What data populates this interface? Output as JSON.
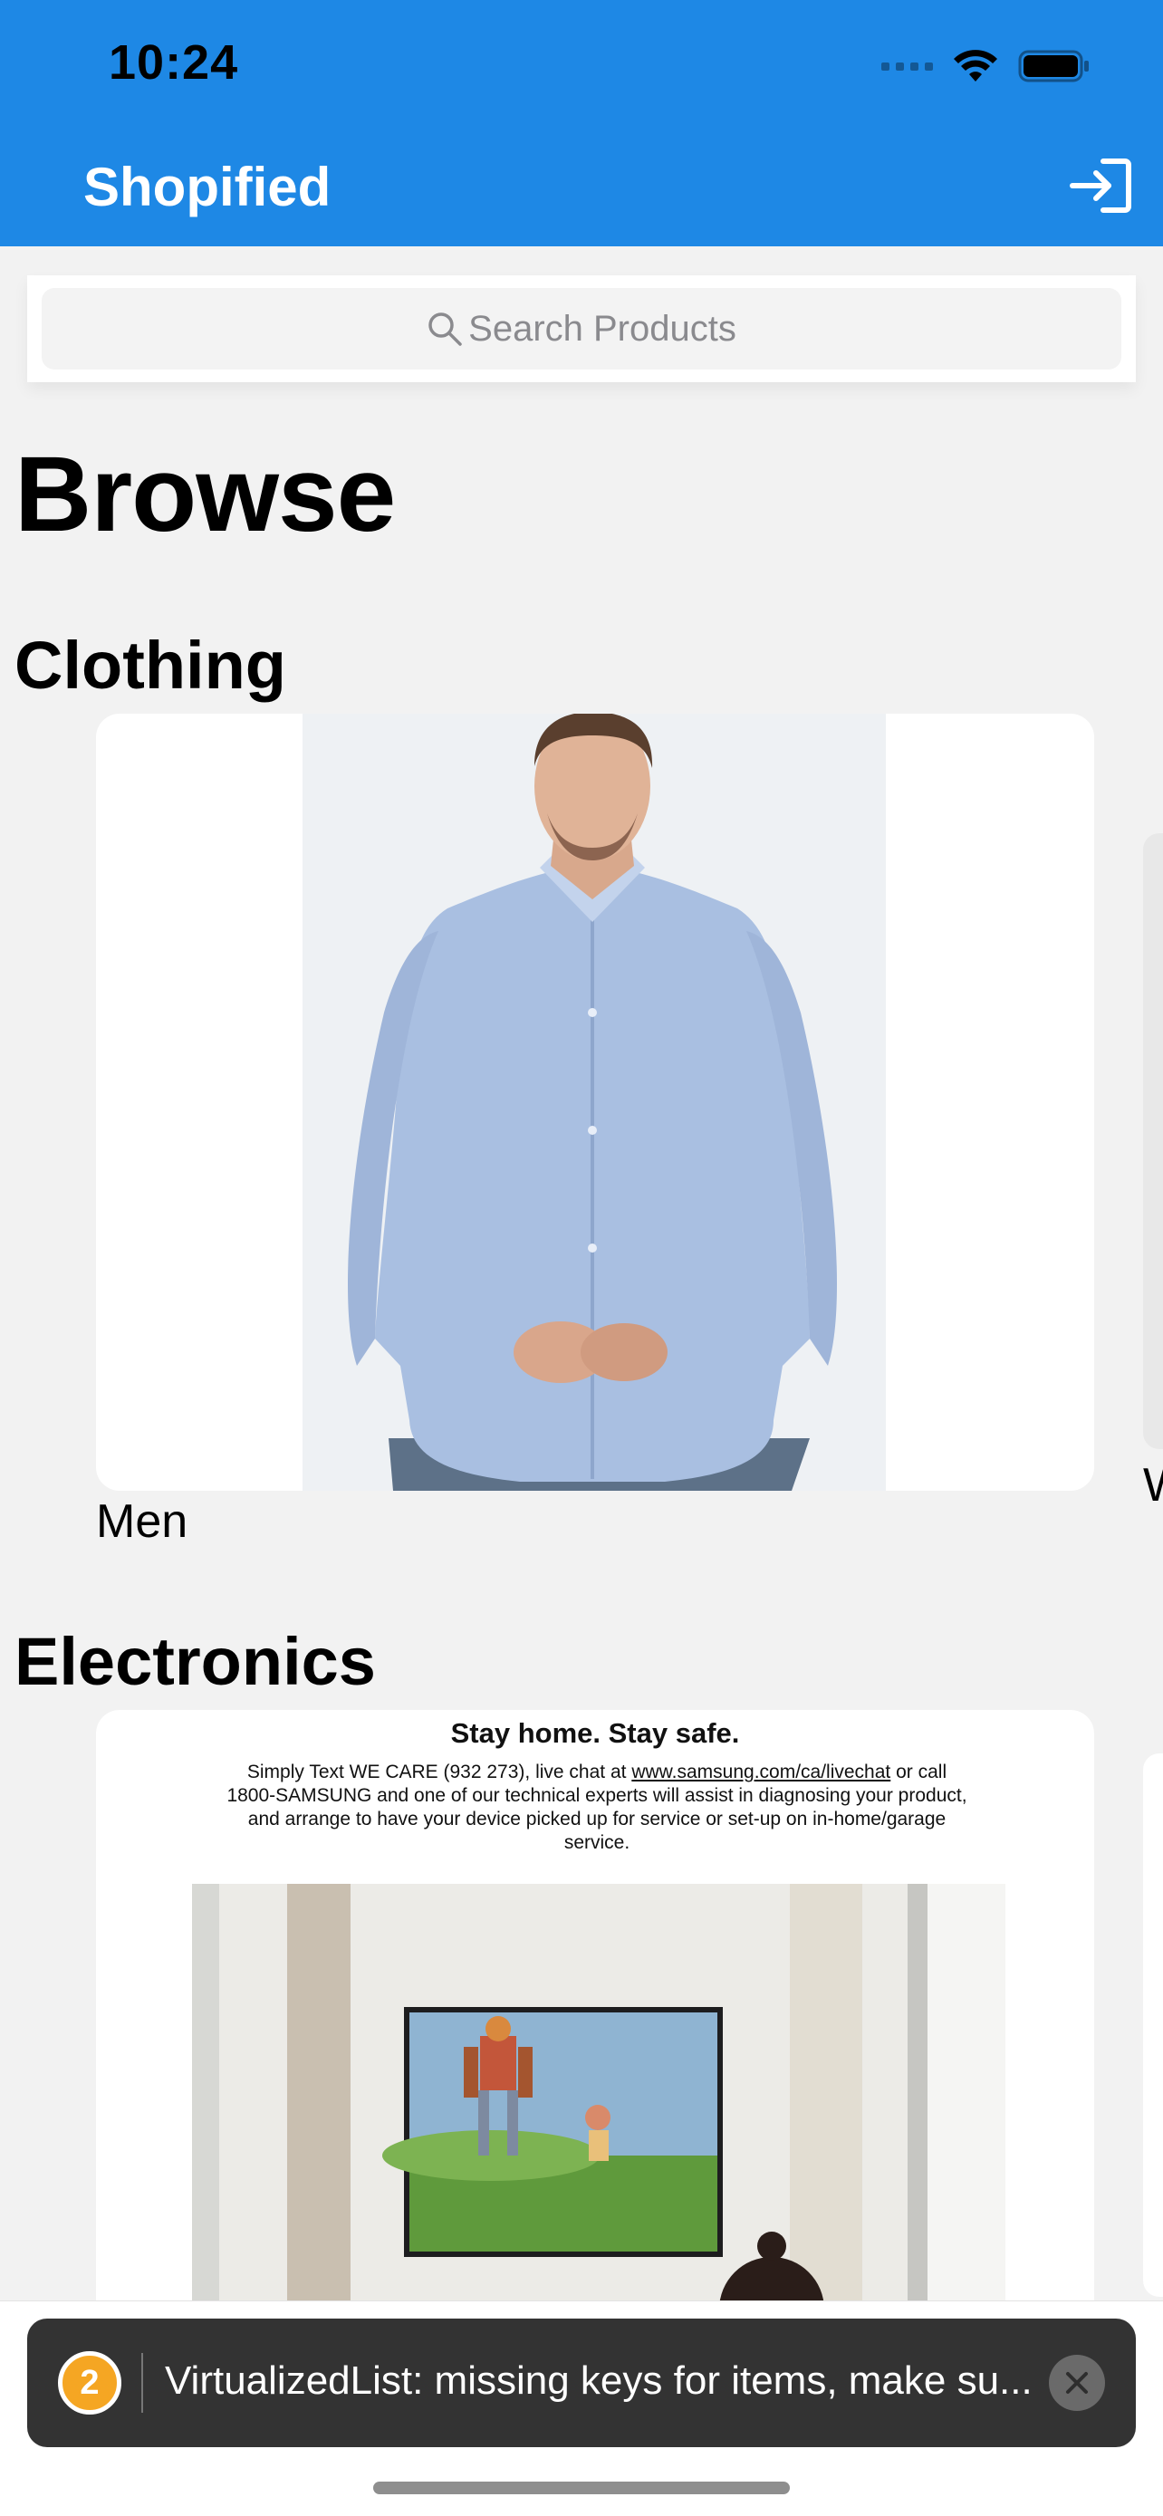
{
  "status_bar": {
    "time": "10:24"
  },
  "header": {
    "title": "Shopified",
    "login_icon": "login-arrow-icon"
  },
  "search": {
    "placeholder": "Search Products",
    "icon": "search-icon"
  },
  "browse_title": "Browse",
  "sections": [
    {
      "title": "Clothing",
      "items": [
        {
          "label": "Men"
        },
        {
          "label": "W"
        }
      ]
    },
    {
      "title": "Electronics",
      "ad": {
        "headline": "Stay home. Stay safe.",
        "body_prefix": "Simply Text WE CARE (932 273), live chat at ",
        "link": "www.samsung.com/ca/livechat",
        "body_suffix": " or call 1800-SAMSUNG and one of our technical experts will assist in diagnosing your product, and arrange to have your device picked up for service or set-up on in-home/garage service."
      }
    }
  ],
  "toast": {
    "badge_count": "2",
    "message": "VirtualizedList: missing keys for items, make su...",
    "close_icon": "close-icon"
  },
  "colors": {
    "header": "#1e88e5",
    "background": "#f2f2f2",
    "toast": "#333333",
    "badge": "#f5a623"
  }
}
